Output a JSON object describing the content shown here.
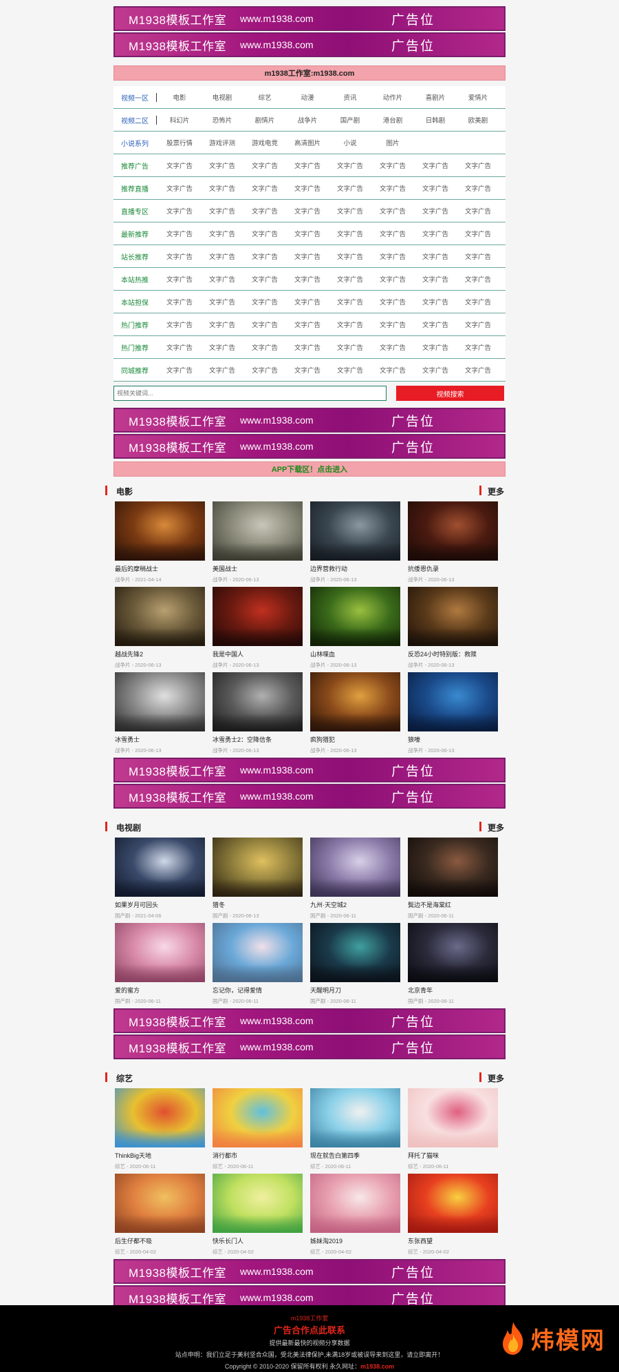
{
  "banner": {
    "brand": "M1938模板工作室",
    "url": "www.m1938.com",
    "ad": "广告位"
  },
  "top_notice": "m1938工作室:m1938.com",
  "nav_rows": [
    {
      "cat": "视频一区",
      "style": "blue",
      "sep": true,
      "links": [
        "电影",
        "电视剧",
        "综艺",
        "动漫",
        "资讯",
        "动作片",
        "喜剧片",
        "爱情片"
      ]
    },
    {
      "cat": "视频二区",
      "style": "blue",
      "sep": true,
      "links": [
        "科幻片",
        "恐怖片",
        "剧情片",
        "战争片",
        "国产剧",
        "港台剧",
        "日韩剧",
        "欧美剧"
      ]
    },
    {
      "cat": "小说系列",
      "style": "blue",
      "sep": false,
      "links": [
        "股票行情",
        "游戏评测",
        "游戏电竞",
        "高清图片",
        "小说",
        "图片",
        "",
        ""
      ]
    },
    {
      "cat": "推荐广告",
      "style": "green",
      "sep": false,
      "links": [
        "文字广告",
        "文字广告",
        "文字广告",
        "文字广告",
        "文字广告",
        "文字广告",
        "文字广告",
        "文字广告"
      ]
    },
    {
      "cat": "推荐直播",
      "style": "green",
      "sep": false,
      "links": [
        "文字广告",
        "文字广告",
        "文字广告",
        "文字广告",
        "文字广告",
        "文字广告",
        "文字广告",
        "文字广告"
      ]
    },
    {
      "cat": "直播专区",
      "style": "green",
      "sep": false,
      "links": [
        "文字广告",
        "文字广告",
        "文字广告",
        "文字广告",
        "文字广告",
        "文字广告",
        "文字广告",
        "文字广告"
      ]
    },
    {
      "cat": "最新推荐",
      "style": "green",
      "sep": false,
      "links": [
        "文字广告",
        "文字广告",
        "文字广告",
        "文字广告",
        "文字广告",
        "文字广告",
        "文字广告",
        "文字广告"
      ]
    },
    {
      "cat": "站长推荐",
      "style": "green",
      "sep": false,
      "links": [
        "文字广告",
        "文字广告",
        "文字广告",
        "文字广告",
        "文字广告",
        "文字广告",
        "文字广告",
        "文字广告"
      ]
    },
    {
      "cat": "本站热推",
      "style": "green",
      "sep": false,
      "links": [
        "文字广告",
        "文字广告",
        "文字广告",
        "文字广告",
        "文字广告",
        "文字广告",
        "文字广告",
        "文字广告"
      ]
    },
    {
      "cat": "本站担保",
      "style": "green",
      "sep": false,
      "links": [
        "文字广告",
        "文字广告",
        "文字广告",
        "文字广告",
        "文字广告",
        "文字广告",
        "文字广告",
        "文字广告"
      ]
    },
    {
      "cat": "热门推荐",
      "style": "green",
      "sep": false,
      "links": [
        "文字广告",
        "文字广告",
        "文字广告",
        "文字广告",
        "文字广告",
        "文字广告",
        "文字广告",
        "文字广告"
      ]
    },
    {
      "cat": "热门推荐",
      "style": "green",
      "sep": false,
      "links": [
        "文字广告",
        "文字广告",
        "文字广告",
        "文字广告",
        "文字广告",
        "文字广告",
        "文字广告",
        "文字广告"
      ]
    },
    {
      "cat": "同城推荐",
      "style": "green",
      "sep": false,
      "links": [
        "文字广告",
        "文字广告",
        "文字广告",
        "文字广告",
        "文字广告",
        "文字广告",
        "文字广告",
        "文字广告"
      ]
    }
  ],
  "search": {
    "placeholder": "视频关键词...",
    "button": "视频搜索"
  },
  "app_bar": "APP下载区！点击进入",
  "sections": [
    {
      "title": "电影",
      "more": "更多",
      "items": [
        {
          "title": "最后的摩稍战士",
          "meta": "战争片 - 2021-04-14",
          "colors": [
            "#7a3a12",
            "#d88a3a",
            "#2a1208"
          ]
        },
        {
          "title": "美国战士",
          "meta": "战争片 - 2020-06-13",
          "colors": [
            "#8a8a7a",
            "#c9c6b8",
            "#3a3a30"
          ]
        },
        {
          "title": "边界营救行动",
          "meta": "战争片 - 2020-06-13",
          "colors": [
            "#3a4650",
            "#8a98a2",
            "#151a20"
          ]
        },
        {
          "title": "抗倭恩仇录",
          "meta": "战争片 - 2020-06-13",
          "colors": [
            "#4a1a10",
            "#a05030",
            "#1a0a06"
          ]
        },
        {
          "title": "越战先锋2",
          "meta": "战争片 - 2020-06-13",
          "colors": [
            "#6a5a3a",
            "#b8a070",
            "#20180c"
          ]
        },
        {
          "title": "我是中国人",
          "meta": "战争片 - 2020-06-13",
          "colors": [
            "#6a1a10",
            "#c03020",
            "#200806"
          ]
        },
        {
          "title": "山林喋血",
          "meta": "战争片 - 2020-06-13",
          "colors": [
            "#3a6a1a",
            "#9ac040",
            "#102006"
          ]
        },
        {
          "title": "反恐24小时特别版：救赎",
          "meta": "战争片 - 2020-06-13",
          "colors": [
            "#5a3a1a",
            "#b07a40",
            "#1a1008"
          ]
        },
        {
          "title": "冰雪勇士",
          "meta": "战争片 - 2020-06-13",
          "colors": [
            "#8a8a8a",
            "#e0e0e0",
            "#2a2a2a"
          ]
        },
        {
          "title": "冰雪勇士2：空降信条",
          "meta": "战争片 - 2020-06-13",
          "colors": [
            "#5a5a5a",
            "#b0b0b0",
            "#1a1a1a"
          ]
        },
        {
          "title": "疯狗猎犯",
          "meta": "战争片 - 2020-06-13",
          "colors": [
            "#8a4a1a",
            "#e0a040",
            "#2a1408"
          ]
        },
        {
          "title": "狼嚎",
          "meta": "战争片 - 2020-06-13",
          "colors": [
            "#1a4a8a",
            "#3a8ad0",
            "#081a3a"
          ]
        }
      ]
    },
    {
      "title": "电视剧",
      "more": "更多",
      "items": [
        {
          "title": "如果岁月可回头",
          "meta": "国产剧 - 2021-04-06",
          "colors": [
            "#3a4a6a",
            "#d0d8e8",
            "#10182a"
          ]
        },
        {
          "title": "猎冬",
          "meta": "国产剧 - 2020-06-13",
          "colors": [
            "#8a7a3a",
            "#e0c060",
            "#2a2010"
          ]
        },
        {
          "title": "九州·天空城2",
          "meta": "国产剧 - 2020-06-11",
          "colors": [
            "#8a7aa8",
            "#d8d0e8",
            "#3a3050"
          ]
        },
        {
          "title": "鬓边不是海棠红",
          "meta": "国产剧 - 2020-06-11",
          "colors": [
            "#3a2a20",
            "#8a5a40",
            "#100a08"
          ]
        },
        {
          "title": "爱的蜜方",
          "meta": "国产剧 - 2020-06-11",
          "colors": [
            "#d88aa8",
            "#f8d8e8",
            "#8a4060"
          ]
        },
        {
          "title": "忘记你，记得爱情",
          "meta": "国产剧 - 2020-06-11",
          "colors": [
            "#6aa8d8",
            "#f0e0e8",
            "#4a6a8a"
          ]
        },
        {
          "title": "天醒明月刀",
          "meta": "国产剧 - 2020-06-11",
          "colors": [
            "#1a3a4a",
            "#40a0a0",
            "#0a1018"
          ]
        },
        {
          "title": "北京青年",
          "meta": "国产剧 - 2020-06-11",
          "colors": [
            "#2a2a3a",
            "#6a6a8a",
            "#0a0a10"
          ]
        }
      ]
    },
    {
      "title": "综艺",
      "more": "更多",
      "items": [
        {
          "title": "ThinkBig天地",
          "meta": "综艺 - 2020-06-11",
          "colors": [
            "#e8c030",
            "#e05030",
            "#3a90d0"
          ]
        },
        {
          "title": "消行都市",
          "meta": "综艺 - 2020-06-11",
          "colors": [
            "#f0d040",
            "#60c0e0",
            "#f08040"
          ]
        },
        {
          "title": "现在就告白第四季",
          "meta": "综艺 - 2020-06-11",
          "colors": [
            "#8ad0e8",
            "#f0f0f0",
            "#3a80a0"
          ]
        },
        {
          "title": "拜托了猫咪",
          "meta": "综艺 - 2020-06-11",
          "colors": [
            "#f8e0e0",
            "#e06080",
            "#f0c0c0"
          ]
        },
        {
          "title": "后生仔都不吸",
          "meta": "综艺 - 2020-04-02",
          "colors": [
            "#e08040",
            "#f0c060",
            "#8a4020"
          ]
        },
        {
          "title": "快乐长门人",
          "meta": "综艺 - 2020-04-02",
          "colors": [
            "#c0e060",
            "#f0f0a0",
            "#40a040"
          ]
        },
        {
          "title": "姊妹淘2019",
          "meta": "综艺 - 2020-04-02",
          "colors": [
            "#e8a0b0",
            "#f8e8e8",
            "#c06080"
          ]
        },
        {
          "title": "东张西望",
          "meta": "综艺 - 2020-04-02",
          "colors": [
            "#e84020",
            "#f8d040",
            "#a01810"
          ]
        }
      ]
    }
  ],
  "footer": {
    "line1": "m1938工作室",
    "line2": "广告合作点此联系",
    "line3": "提供最新最快的视频分享数据",
    "line4": "站点申明：我们立足于美利坚合众国，受北美法律保护,未满18岁或被误导来到这里，请立即离开！",
    "line5_prefix": "Copyright © 2010-2020 保留所有权利 永久网址：",
    "line5_url": "m1938.com",
    "logo_text": "炜模网"
  }
}
